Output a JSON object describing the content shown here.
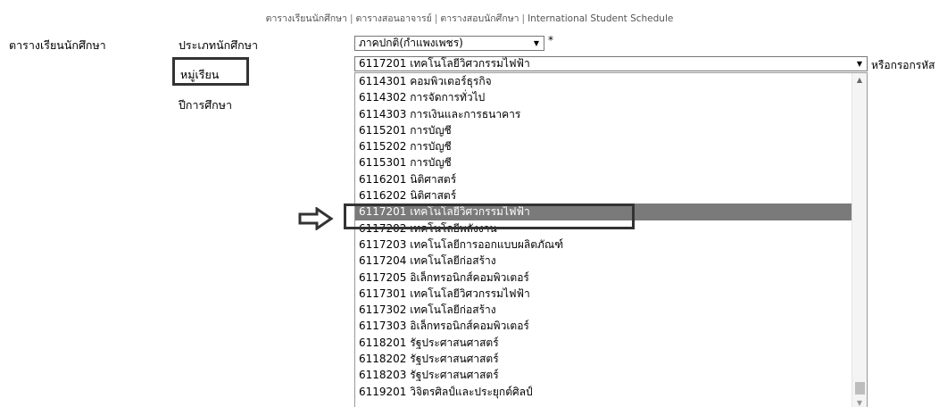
{
  "topnav": {
    "items": [
      "ตารางเรียนนักศึกษา",
      "ตารางสอนอาจารย์",
      "ตารางสอบนักศึกษา",
      "International Student Schedule"
    ],
    "separator": "|"
  },
  "page_title": "ตารางเรียนนักศึกษา",
  "form": {
    "student_type_label": "ประเภทนักศึกษา",
    "student_type_value": "ภาคปกติ(กำแพงเพชร)",
    "required_mark": "*",
    "group_label": "หมู่เรียน",
    "group_value": "6117201  เทคโนโลยีวิศวกรรมไฟฟ้า",
    "or_enter_code": "หรือกรอกรหัส",
    "year_label": "ปีการศึกษา"
  },
  "dropdown_options": [
    "6114301  คอมพิวเตอร์ธุรกิจ",
    "6114302  การจัดการทั่วไป",
    "6114303  การเงินและการธนาคาร",
    "6115201  การบัญชี",
    "6115202  การบัญชี",
    "6115301  การบัญชี",
    "6116201  นิติศาสตร์",
    "6116202  นิติศาสตร์",
    "6117201  เทคโนโลยีวิศวกรรมไฟฟ้า",
    "6117202  เทคโนโลยีพลังงาน",
    "6117203  เทคโนโลยีการออกแบบผลิตภัณฑ์",
    "6117204  เทคโนโลยีก่อสร้าง",
    "6117205  อิเล็กทรอนิกส์คอมพิวเตอร์",
    "6117301  เทคโนโลยีวิศวกรรมไฟฟ้า",
    "6117302  เทคโนโลยีก่อสร้าง",
    "6117303  อิเล็กทรอนิกส์คอมพิวเตอร์",
    "6118201  รัฐประศาสนศาสตร์",
    "6118202  รัฐประศาสนศาสตร์",
    "6118203  รัฐประศาสนศาสตร์",
    "6119201  วิจิตรศิลป์และประยุกต์ศิลป์"
  ],
  "selected_index": 8,
  "icons": {
    "pointer_arrow": "right-arrow-icon",
    "select_arrow": "▼",
    "scroll_up": "▲",
    "scroll_down": "▼"
  },
  "colors": {
    "selected_bg": "#7a7a7a",
    "highlight_border": "#333333"
  }
}
